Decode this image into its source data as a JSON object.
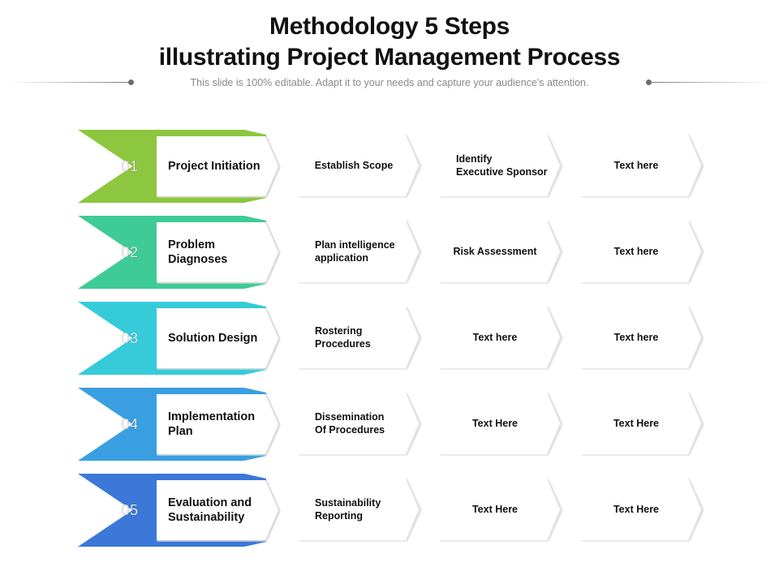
{
  "header": {
    "title_line1": "Methodology 5 Steps",
    "title_line2": "illustrating Project Management Process",
    "subtitle": "This slide is 100% editable. Adapt it to your needs and capture your audience's attention."
  },
  "colors": {
    "step1": "#8dc63f",
    "step2": "#3fcb97",
    "step3": "#36cbd9",
    "step4": "#3a9fe0",
    "step5": "#3b78d8"
  },
  "rows": [
    {
      "number": "01",
      "title": "Project Initiation",
      "steps": [
        "Establish Scope",
        "Identify\nExecutive Sponsor",
        "Text here"
      ]
    },
    {
      "number": "02",
      "title": "Problem\nDiagnoses",
      "steps": [
        "Plan intelligence\napplication",
        "Risk Assessment",
        "Text here"
      ]
    },
    {
      "number": "03",
      "title": "Solution Design",
      "steps": [
        "Rostering\nProcedures",
        "Text here",
        "Text here"
      ]
    },
    {
      "number": "04",
      "title": "Implementation\nPlan",
      "steps": [
        "Dissemination\nOf Procedures",
        "Text Here",
        "Text Here"
      ]
    },
    {
      "number": "05",
      "title": "Evaluation and\nSustainability",
      "steps": [
        "Sustainability\nReporting",
        "Text Here",
        "Text Here"
      ]
    }
  ]
}
